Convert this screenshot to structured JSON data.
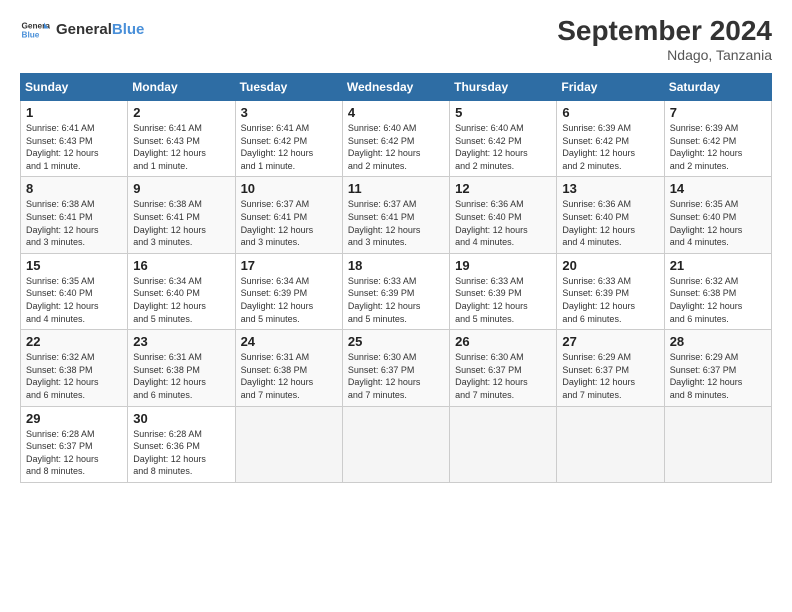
{
  "header": {
    "logo_line1": "General",
    "logo_line2": "Blue",
    "month": "September 2024",
    "location": "Ndago, Tanzania"
  },
  "days_of_week": [
    "Sunday",
    "Monday",
    "Tuesday",
    "Wednesday",
    "Thursday",
    "Friday",
    "Saturday"
  ],
  "weeks": [
    [
      {
        "day": "1",
        "info": "Sunrise: 6:41 AM\nSunset: 6:43 PM\nDaylight: 12 hours\nand 1 minute."
      },
      {
        "day": "2",
        "info": "Sunrise: 6:41 AM\nSunset: 6:43 PM\nDaylight: 12 hours\nand 1 minute."
      },
      {
        "day": "3",
        "info": "Sunrise: 6:41 AM\nSunset: 6:42 PM\nDaylight: 12 hours\nand 1 minute."
      },
      {
        "day": "4",
        "info": "Sunrise: 6:40 AM\nSunset: 6:42 PM\nDaylight: 12 hours\nand 2 minutes."
      },
      {
        "day": "5",
        "info": "Sunrise: 6:40 AM\nSunset: 6:42 PM\nDaylight: 12 hours\nand 2 minutes."
      },
      {
        "day": "6",
        "info": "Sunrise: 6:39 AM\nSunset: 6:42 PM\nDaylight: 12 hours\nand 2 minutes."
      },
      {
        "day": "7",
        "info": "Sunrise: 6:39 AM\nSunset: 6:42 PM\nDaylight: 12 hours\nand 2 minutes."
      }
    ],
    [
      {
        "day": "8",
        "info": "Sunrise: 6:38 AM\nSunset: 6:41 PM\nDaylight: 12 hours\nand 3 minutes."
      },
      {
        "day": "9",
        "info": "Sunrise: 6:38 AM\nSunset: 6:41 PM\nDaylight: 12 hours\nand 3 minutes."
      },
      {
        "day": "10",
        "info": "Sunrise: 6:37 AM\nSunset: 6:41 PM\nDaylight: 12 hours\nand 3 minutes."
      },
      {
        "day": "11",
        "info": "Sunrise: 6:37 AM\nSunset: 6:41 PM\nDaylight: 12 hours\nand 3 minutes."
      },
      {
        "day": "12",
        "info": "Sunrise: 6:36 AM\nSunset: 6:40 PM\nDaylight: 12 hours\nand 4 minutes."
      },
      {
        "day": "13",
        "info": "Sunrise: 6:36 AM\nSunset: 6:40 PM\nDaylight: 12 hours\nand 4 minutes."
      },
      {
        "day": "14",
        "info": "Sunrise: 6:35 AM\nSunset: 6:40 PM\nDaylight: 12 hours\nand 4 minutes."
      }
    ],
    [
      {
        "day": "15",
        "info": "Sunrise: 6:35 AM\nSunset: 6:40 PM\nDaylight: 12 hours\nand 4 minutes."
      },
      {
        "day": "16",
        "info": "Sunrise: 6:34 AM\nSunset: 6:40 PM\nDaylight: 12 hours\nand 5 minutes."
      },
      {
        "day": "17",
        "info": "Sunrise: 6:34 AM\nSunset: 6:39 PM\nDaylight: 12 hours\nand 5 minutes."
      },
      {
        "day": "18",
        "info": "Sunrise: 6:33 AM\nSunset: 6:39 PM\nDaylight: 12 hours\nand 5 minutes."
      },
      {
        "day": "19",
        "info": "Sunrise: 6:33 AM\nSunset: 6:39 PM\nDaylight: 12 hours\nand 5 minutes."
      },
      {
        "day": "20",
        "info": "Sunrise: 6:33 AM\nSunset: 6:39 PM\nDaylight: 12 hours\nand 6 minutes."
      },
      {
        "day": "21",
        "info": "Sunrise: 6:32 AM\nSunset: 6:38 PM\nDaylight: 12 hours\nand 6 minutes."
      }
    ],
    [
      {
        "day": "22",
        "info": "Sunrise: 6:32 AM\nSunset: 6:38 PM\nDaylight: 12 hours\nand 6 minutes."
      },
      {
        "day": "23",
        "info": "Sunrise: 6:31 AM\nSunset: 6:38 PM\nDaylight: 12 hours\nand 6 minutes."
      },
      {
        "day": "24",
        "info": "Sunrise: 6:31 AM\nSunset: 6:38 PM\nDaylight: 12 hours\nand 7 minutes."
      },
      {
        "day": "25",
        "info": "Sunrise: 6:30 AM\nSunset: 6:37 PM\nDaylight: 12 hours\nand 7 minutes."
      },
      {
        "day": "26",
        "info": "Sunrise: 6:30 AM\nSunset: 6:37 PM\nDaylight: 12 hours\nand 7 minutes."
      },
      {
        "day": "27",
        "info": "Sunrise: 6:29 AM\nSunset: 6:37 PM\nDaylight: 12 hours\nand 7 minutes."
      },
      {
        "day": "28",
        "info": "Sunrise: 6:29 AM\nSunset: 6:37 PM\nDaylight: 12 hours\nand 8 minutes."
      }
    ],
    [
      {
        "day": "29",
        "info": "Sunrise: 6:28 AM\nSunset: 6:37 PM\nDaylight: 12 hours\nand 8 minutes."
      },
      {
        "day": "30",
        "info": "Sunrise: 6:28 AM\nSunset: 6:36 PM\nDaylight: 12 hours\nand 8 minutes."
      },
      {
        "day": "",
        "info": ""
      },
      {
        "day": "",
        "info": ""
      },
      {
        "day": "",
        "info": ""
      },
      {
        "day": "",
        "info": ""
      },
      {
        "day": "",
        "info": ""
      }
    ]
  ]
}
